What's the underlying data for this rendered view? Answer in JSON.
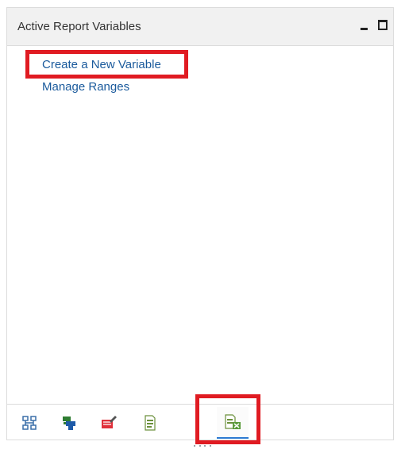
{
  "panel": {
    "title": "Active Report Variables",
    "minimize_label": "_",
    "maximize_label": "□"
  },
  "links": [
    {
      "label": "Create a New Variable",
      "highlighted": true
    },
    {
      "label": "Manage Ranges",
      "highlighted": false
    }
  ],
  "tabs": [
    {
      "icon": "hierarchy-icon",
      "active": false
    },
    {
      "icon": "data-tree-icon",
      "active": false
    },
    {
      "icon": "filter-edit-icon",
      "active": false
    },
    {
      "icon": "report-document-icon",
      "active": false
    },
    {
      "icon": "report-variables-icon",
      "active": true,
      "highlighted": true
    }
  ],
  "colors": {
    "highlight": "#e01b22",
    "link": "#1a5a9c",
    "header_bg": "#f1f1f1",
    "active_tab_underline": "#2d7ad1"
  }
}
